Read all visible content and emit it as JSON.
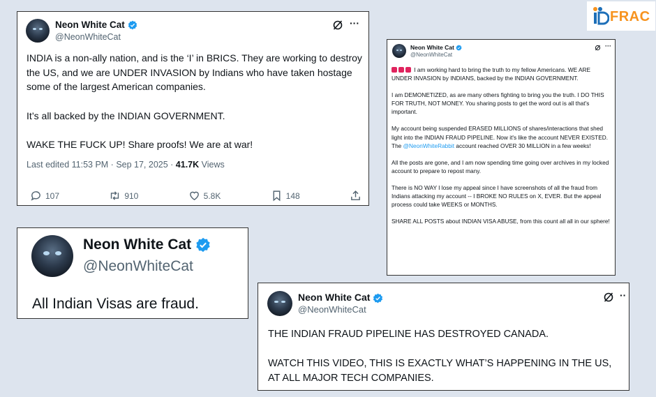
{
  "logo": {
    "text": "FRAC"
  },
  "colors": {
    "accent_blue": "#1d9bf0",
    "logo_orange": "#f7931e",
    "siren_red": "#e0245e"
  },
  "tweet1": {
    "name": "Neon White Cat",
    "handle": "@NeonWhiteCat",
    "p1": "INDIA is a non-ally nation, and is the ‘I’ in BRICS. They are working to destroy the US, and we are UNDER INVASION by Indians who have taken hostage some of the largest American companies.",
    "p2": "It’s all backed by the INDIAN GOVERNMENT.",
    "p3": "WAKE THE FUCK UP! Share proofs! We are at war!",
    "meta_prefix": "Last edited 11:53 PM · Sep 17, 2025 · ",
    "views_count": "41.7K",
    "views_label": " Views",
    "replies": "107",
    "reposts": "910",
    "likes": "5.8K",
    "bookmarks": "148"
  },
  "tweet2": {
    "name": "Neon White Cat",
    "handle": "@NeonWhiteCat",
    "text": "All Indian Visas are fraud."
  },
  "tweet3": {
    "name": "Neon White Cat",
    "handle": "@NeonWhiteCat",
    "p1": "I am working hard to bring the truth to my fellow Americans. WE ARE UNDER INVASION by INDIANS, backed by the INDIAN GOVERNMENT.",
    "p2": "I am DEMONETIZED, as are many others fighting to bring you the truth. I DO THIS FOR TRUTH, NOT MONEY. You sharing posts to get the word out is all that's important.",
    "p3_a": "My account being suspended ERASED MILLIONS of shares/interactions that shed light into the INDIAN FRAUD PIPELINE. Now it's like the account NEVER EXISTED. The ",
    "p3_link": "@NeonWhiteRabbit",
    "p3_b": " account reached OVER 30 MILLION in a few weeks!",
    "p4": "All the posts are gone, and I am now spending time going over archives in my locked account to prepare to repost many.",
    "p5": "There is NO WAY I lose my appeal since I have screenshots of all the fraud from Indians attacking my account -- I BROKE NO RULES on X, EVER. But the appeal process could take WEEKS or MONTHS.",
    "p6": "SHARE ALL POSTS about INDIAN VISA ABUSE, from this count all all in our sphere!"
  },
  "tweet4": {
    "name": "Neon White Cat",
    "handle": "@NeonWhiteCat",
    "p1": "THE INDIAN FRAUD PIPELINE HAS DESTROYED CANADA.",
    "p2": "WATCH THIS VIDEO, THIS IS EXACTLY WHAT’S HAPPENING IN THE US, AT ALL MAJOR TECH COMPANIES."
  },
  "icons": [
    "verified-badge-icon",
    "grok-icon",
    "more-icon",
    "reply-icon",
    "repost-icon",
    "like-icon",
    "bookmark-icon",
    "share-icon",
    "siren-icon"
  ]
}
